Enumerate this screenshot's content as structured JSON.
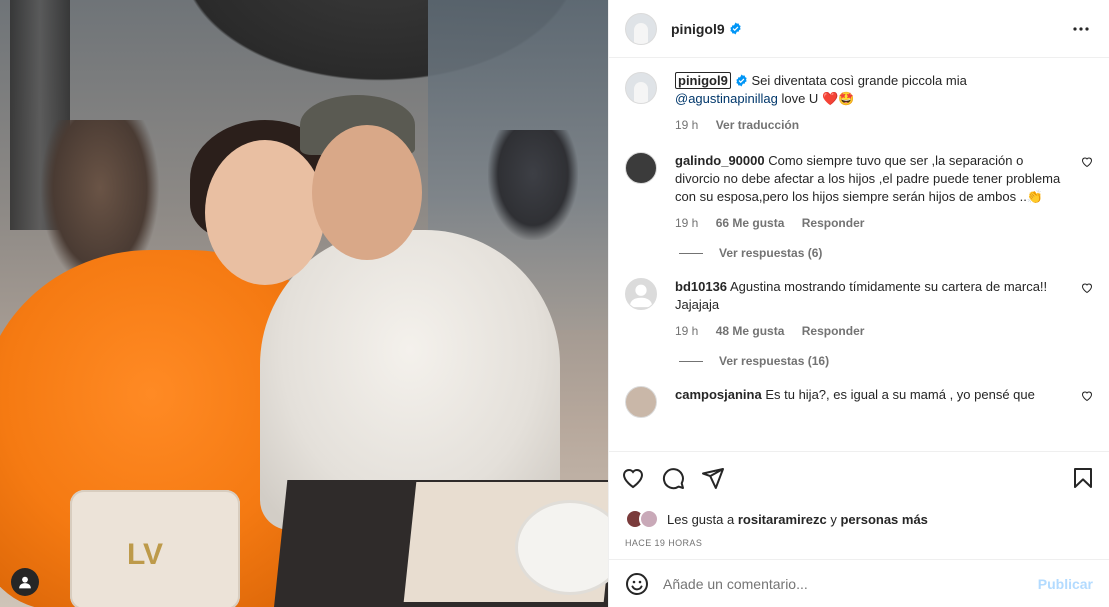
{
  "post": {
    "username": "pinigol9",
    "caption": "Sei diventata così grande piccola mia",
    "caption_mention": "@agustinapinillag",
    "caption_suffix": "love U",
    "caption_emojis": "❤️🤩",
    "caption_time": "19 h",
    "see_translation": "Ver traducción"
  },
  "comments": [
    {
      "username": "galindo_90000",
      "text": "Como siempre tuvo que ser ,la separación o divorcio no debe afectar a los hijos ,el padre puede tener problema con su esposa,pero los hijos siempre serán hijos de ambos ..👏",
      "time": "19 h",
      "likes": "66 Me gusta",
      "reply": "Responder",
      "view_replies": "Ver respuestas (6)"
    },
    {
      "username": "bd10136",
      "text": "Agustina mostrando tímidamente su cartera de marca!! Jajajaja",
      "time": "19 h",
      "likes": "48 Me gusta",
      "reply": "Responder",
      "view_replies": "Ver respuestas (16)"
    },
    {
      "username": "camposjanina",
      "text": "Es tu hija?, es igual a su mamá , yo pensé que"
    }
  ],
  "likes_line": {
    "prefix": "Les gusta a",
    "user": "rositaramirezc",
    "and": "y",
    "others": "personas más"
  },
  "posted_ago": "HACE 19 HORAS",
  "add_comment": {
    "placeholder": "Añade un comentario...",
    "post_label": "Publicar"
  },
  "colors": {
    "verified": "#0095f6",
    "heart_red": "#ed4956",
    "link": "#00376b",
    "publish_disabled": "#b3dbff"
  }
}
